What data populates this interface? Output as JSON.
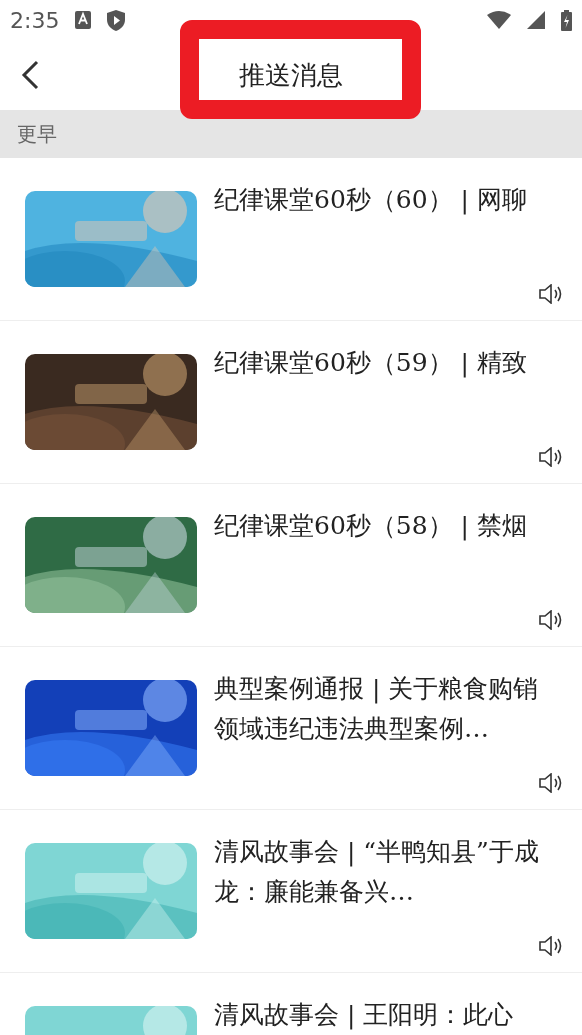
{
  "status_bar": {
    "time": "2:35"
  },
  "header": {
    "title": "推送消息",
    "highlighted": true
  },
  "section": {
    "label": "更早"
  },
  "messages": [
    {
      "title": "纪律课堂60秒（60） | 网聊",
      "audio": true
    },
    {
      "title": "纪律课堂60秒（59） | 精致",
      "audio": true
    },
    {
      "title": "纪律课堂60秒（58） | 禁烟",
      "audio": true
    },
    {
      "title": "典型案例通报 | 关于粮食购销领域违纪违法典型案例…",
      "audio": true
    },
    {
      "title": "清风故事会 | “半鸭知县”于成龙：廉能兼备兴…",
      "audio": true
    },
    {
      "title": "清风故事会 | 王阳明：此心",
      "audio": false
    }
  ]
}
